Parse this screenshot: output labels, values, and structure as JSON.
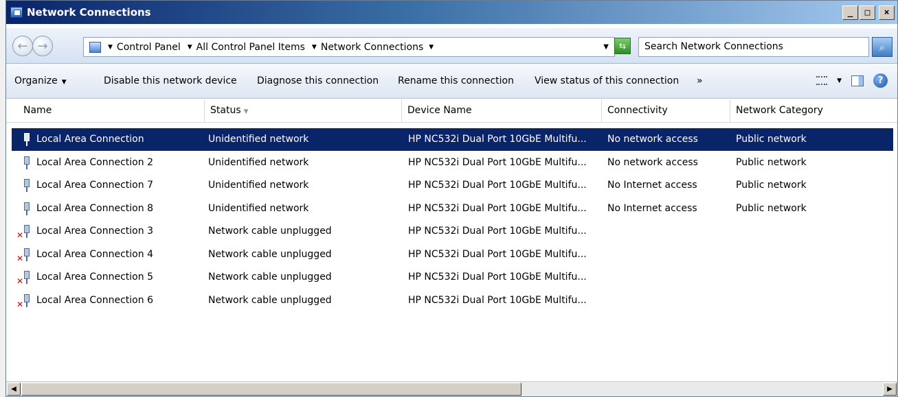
{
  "window": {
    "title": "Network Connections"
  },
  "title_controls": {
    "minimize": "_",
    "maximize": "□",
    "close": "×"
  },
  "address": {
    "crumbs": [
      "Control Panel",
      "All Control Panel Items",
      "Network Connections"
    ],
    "search_placeholder": "Search Network Connections"
  },
  "commands": {
    "organize": "Organize",
    "disable": "Disable this network device",
    "diagnose": "Diagnose this connection",
    "rename": "Rename this connection",
    "view_status": "View status of this connection",
    "more": "»"
  },
  "columns": [
    "Name",
    "Status",
    "Device Name",
    "Connectivity",
    "Network Category"
  ],
  "rows": [
    {
      "name": "Local Area Connection",
      "status": "Unidentified network",
      "device": "HP NC532i Dual Port 10GbE Multifu...",
      "connectivity": "No network access",
      "category": "Public network",
      "unplugged": false,
      "selected": true
    },
    {
      "name": "Local Area Connection 2",
      "status": "Unidentified network",
      "device": "HP NC532i Dual Port 10GbE Multifu...",
      "connectivity": "No network access",
      "category": "Public network",
      "unplugged": false,
      "selected": false
    },
    {
      "name": "Local Area Connection 7",
      "status": "Unidentified network",
      "device": "HP NC532i Dual Port 10GbE Multifu...",
      "connectivity": "No Internet access",
      "category": "Public network",
      "unplugged": false,
      "selected": false
    },
    {
      "name": "Local Area Connection 8",
      "status": "Unidentified network",
      "device": "HP NC532i Dual Port 10GbE Multifu...",
      "connectivity": "No Internet access",
      "category": "Public network",
      "unplugged": false,
      "selected": false
    },
    {
      "name": "Local Area Connection 3",
      "status": "Network cable unplugged",
      "device": "HP NC532i Dual Port 10GbE Multifu...",
      "connectivity": "",
      "category": "",
      "unplugged": true,
      "selected": false
    },
    {
      "name": "Local Area Connection 4",
      "status": "Network cable unplugged",
      "device": "HP NC532i Dual Port 10GbE Multifu...",
      "connectivity": "",
      "category": "",
      "unplugged": true,
      "selected": false
    },
    {
      "name": "Local Area Connection 5",
      "status": "Network cable unplugged",
      "device": "HP NC532i Dual Port 10GbE Multifu...",
      "connectivity": "",
      "category": "",
      "unplugged": true,
      "selected": false
    },
    {
      "name": "Local Area Connection 6",
      "status": "Network cable unplugged",
      "device": "HP NC532i Dual Port 10GbE Multifu...",
      "connectivity": "",
      "category": "",
      "unplugged": true,
      "selected": false
    }
  ],
  "colors": {
    "selection": "#0a246a",
    "title_gradient_start": "#0a246a"
  }
}
